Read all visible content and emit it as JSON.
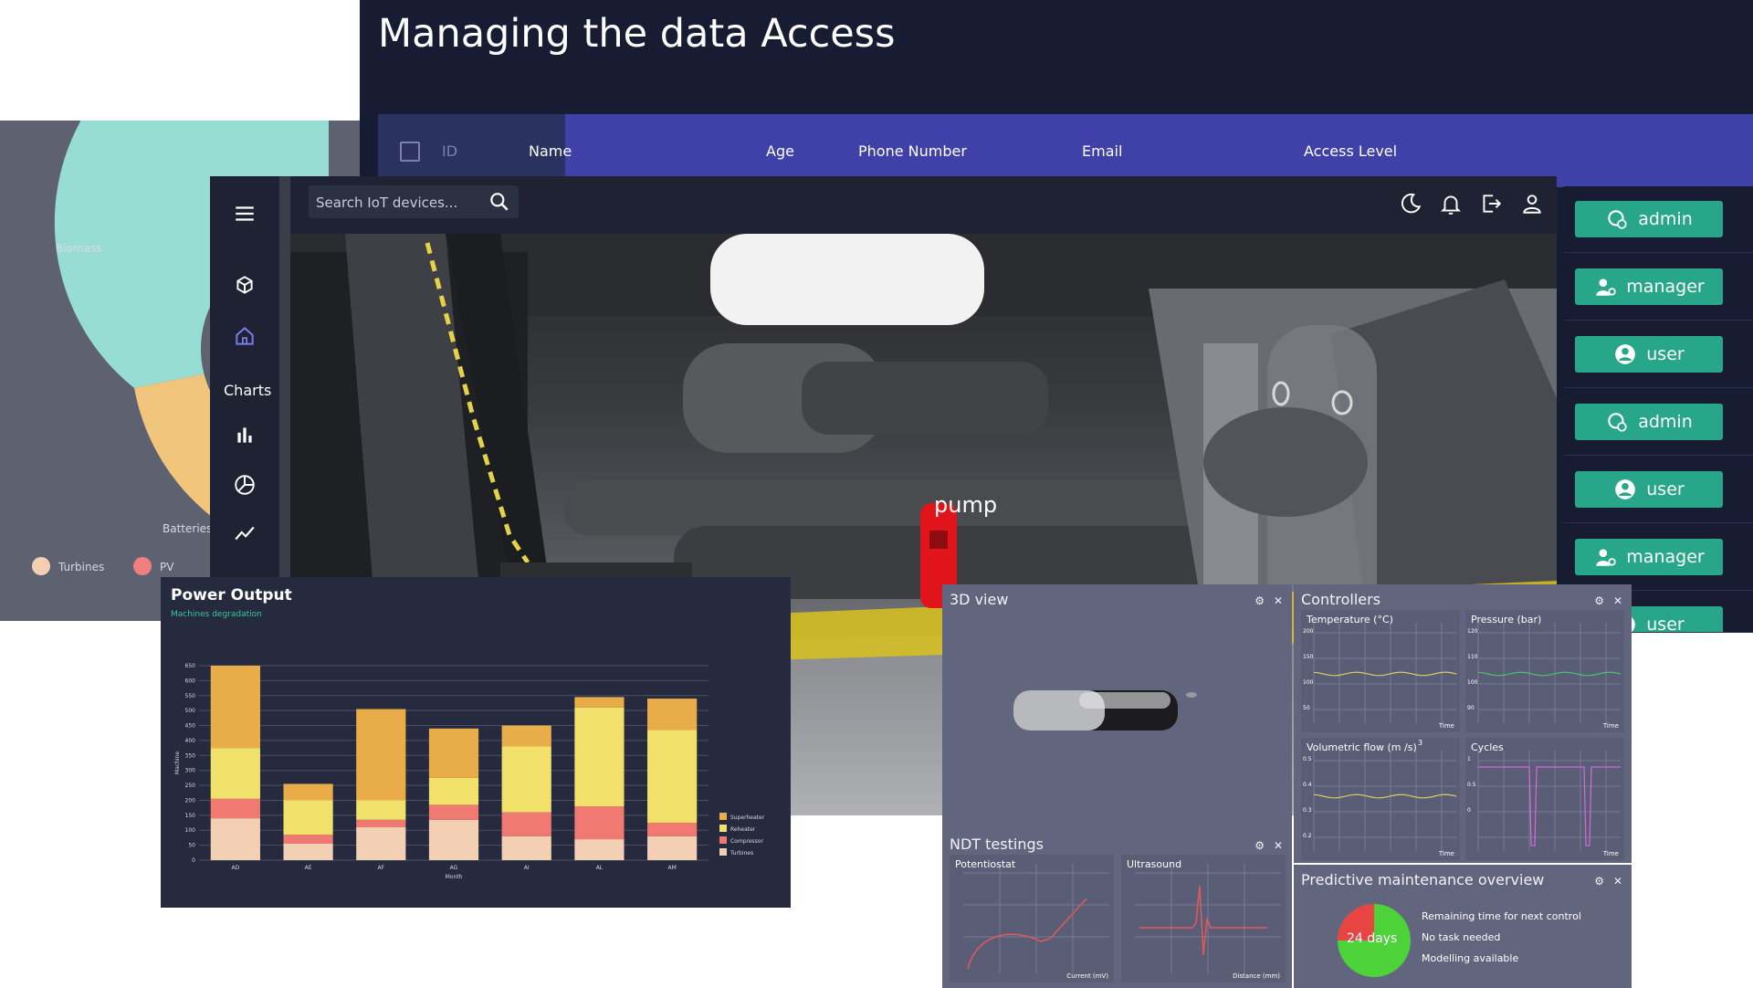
{
  "access_panel": {
    "title": "Managing the data Access",
    "columns": [
      "ID",
      "Name",
      "Age",
      "Phone Number",
      "Email",
      "Access Level"
    ],
    "roles": [
      "admin",
      "manager",
      "user",
      "admin",
      "user",
      "manager",
      "user"
    ],
    "accent": "#28a68a"
  },
  "pie_panel": {
    "labels": [
      "Biomass",
      "Batteries"
    ],
    "legend": [
      {
        "label": "Turbines",
        "color": "#f3cfb4"
      },
      {
        "label": "PV",
        "color": "#f08080"
      }
    ]
  },
  "iot_app": {
    "search_placeholder": "Search IoT devices...",
    "sidebar_section": "Charts",
    "sidebar_icons": [
      "menu-icon",
      "cube-icon",
      "home-icon",
      "bar-chart-icon",
      "pie-chart-icon",
      "line-chart-icon"
    ],
    "topbar_icons": [
      "moon-icon",
      "bell-icon",
      "logout-icon",
      "user-icon"
    ],
    "scene_label": "pump"
  },
  "power_output": {
    "title": "Power Output",
    "subtitle": "Machines degradation"
  },
  "chart_data": {
    "type": "bar",
    "title": "Power Output",
    "xlabel": "Month",
    "ylabel": "Machine",
    "ylim": [
      0,
      650
    ],
    "yticks": [
      0,
      50,
      100,
      150,
      200,
      250,
      300,
      350,
      400,
      450,
      500,
      550,
      600,
      650
    ],
    "categories": [
      "AD",
      "AE",
      "AF",
      "AG",
      "AI",
      "AL",
      "AM"
    ],
    "stacked": true,
    "series": [
      {
        "name": "Turbines",
        "color": "#f3cfb4",
        "values": [
          140,
          55,
          110,
          135,
          80,
          70,
          80
        ]
      },
      {
        "name": "Compressor",
        "color": "#f07a72",
        "values": [
          65,
          30,
          25,
          50,
          80,
          110,
          45
        ]
      },
      {
        "name": "Reheater",
        "color": "#f1e06a",
        "values": [
          170,
          115,
          65,
          90,
          220,
          330,
          310
        ]
      },
      {
        "name": "Superheater",
        "color": "#e8ad48",
        "values": [
          275,
          55,
          305,
          165,
          70,
          35,
          105
        ]
      }
    ]
  },
  "dashboard": {
    "view3d": {
      "title": "3D view"
    },
    "controllers": {
      "title": "Controllers",
      "charts": [
        {
          "title": "Temperature (°C)",
          "x_label": "Time",
          "yticks": [
            "200",
            "150",
            "100",
            "50"
          ],
          "line_color": "#d9cf63"
        },
        {
          "title": "Pressure (bar)",
          "x_label": "Time",
          "yticks": [
            "120",
            "110",
            "100",
            "90"
          ],
          "line_color": "#4cc56a"
        },
        {
          "title": "Volumetric flow (m /s)",
          "sup": "3",
          "x_label": "Time",
          "yticks": [
            "0.5",
            "0.4",
            "0.3",
            "0.2"
          ],
          "line_color": "#d9cf63"
        },
        {
          "title": "Cycles",
          "x_label": "Time",
          "yticks": [
            "1",
            "0.5",
            "0"
          ],
          "line_color": "#d66ad6"
        }
      ]
    },
    "ndt": {
      "title": "NDT testings",
      "charts": [
        {
          "title": "Potentiostat",
          "x_label": "Current (mV)"
        },
        {
          "title": "Ultrasound",
          "x_label": "Distance (mm)"
        }
      ]
    },
    "maintenance": {
      "title": "Predictive maintenance overview",
      "days_label": "24 days",
      "lines": [
        "Remaining time for next control",
        "No task needed",
        "Modelling available"
      ]
    }
  }
}
